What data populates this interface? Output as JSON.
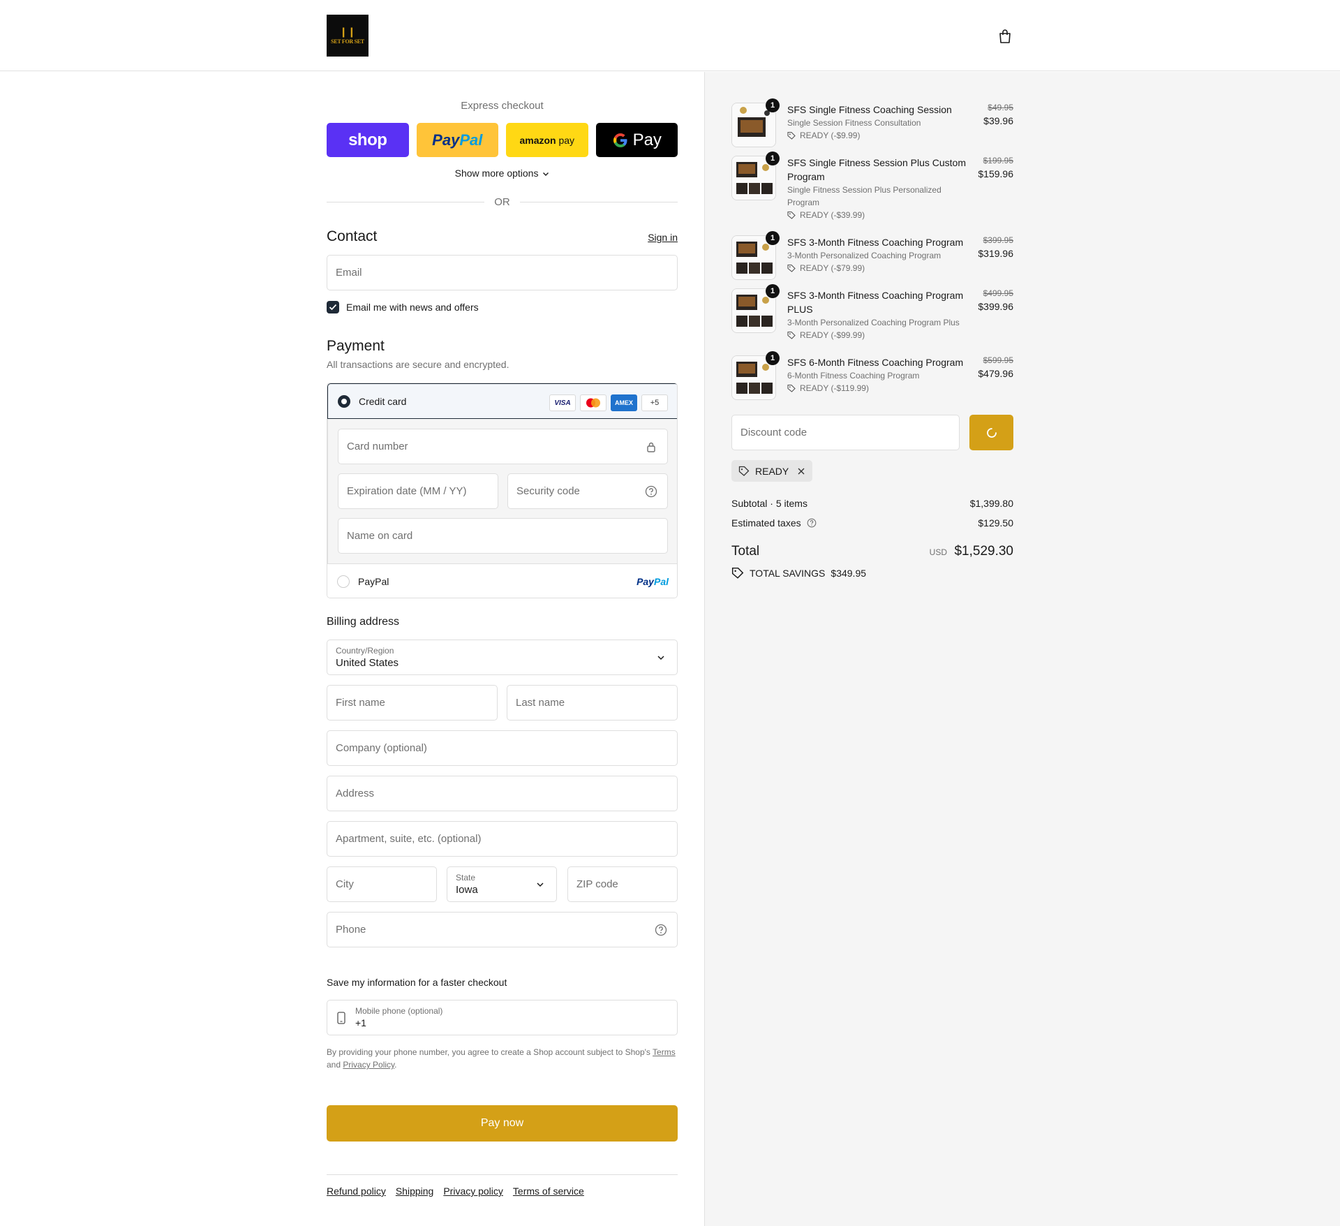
{
  "header": {
    "logo_text": "SET FOR SET",
    "cart_icon": "shopping-bag-icon"
  },
  "express": {
    "label": "Express checkout",
    "shop_label": "shop",
    "paypal_label_a": "Pay",
    "paypal_label_b": "Pal",
    "amazon_label": "amazon",
    "amazon_pay": "pay",
    "gpay_label": "Pay",
    "show_more": "Show more options",
    "or": "OR"
  },
  "contact": {
    "title": "Contact",
    "sign_in": "Sign in",
    "email_placeholder": "Email",
    "news_label": "Email me with news and offers",
    "news_checked": true
  },
  "payment": {
    "title": "Payment",
    "subtitle": "All transactions are secure and encrypted.",
    "credit_card_label": "Credit card",
    "card_brands": [
      "VISA",
      "",
      "AMEX",
      "+5"
    ],
    "card_number_placeholder": "Card number",
    "expiration_placeholder": "Expiration date (MM / YY)",
    "security_placeholder": "Security code",
    "name_placeholder": "Name on card",
    "paypal_label": "PayPal",
    "paypal_logo_a": "Pay",
    "paypal_logo_b": "Pal"
  },
  "billing": {
    "title": "Billing address",
    "country_label": "Country/Region",
    "country_value": "United States",
    "first_name_placeholder": "First name",
    "last_name_placeholder": "Last name",
    "company_placeholder": "Company (optional)",
    "address_placeholder": "Address",
    "apartment_placeholder": "Apartment, suite, etc. (optional)",
    "city_placeholder": "City",
    "state_label": "State",
    "state_value": "Iowa",
    "zip_placeholder": "ZIP code",
    "phone_placeholder": "Phone"
  },
  "save_info": {
    "title": "Save my information for a faster checkout",
    "mobile_label": "Mobile phone (optional)",
    "mobile_value": "+1",
    "legal_a": "By providing your phone number, you agree to create a Shop account subject to Shop's ",
    "legal_terms": "Terms",
    "legal_b": " and ",
    "legal_privacy": "Privacy Policy",
    "legal_c": "."
  },
  "pay_now": "Pay now",
  "footer_links": [
    "Refund policy",
    "Shipping",
    "Privacy policy",
    "Terms of service"
  ],
  "order": {
    "items": [
      {
        "qty": "1",
        "name": "SFS Single Fitness Coaching Session",
        "subtitle": "Single Session Fitness Consultation",
        "discount": "READY (-$9.99)",
        "original": "$49.95",
        "price": "$39.96"
      },
      {
        "qty": "1",
        "name": "SFS Single Fitness Session Plus Custom Program",
        "subtitle": "Single Fitness Session Plus Personalized Program",
        "discount": "READY (-$39.99)",
        "original": "$199.95",
        "price": "$159.96"
      },
      {
        "qty": "1",
        "name": "SFS 3-Month Fitness Coaching Program",
        "subtitle": "3-Month Personalized Coaching Program",
        "discount": "READY (-$79.99)",
        "original": "$399.95",
        "price": "$319.96"
      },
      {
        "qty": "1",
        "name": "SFS 3-Month Fitness Coaching Program PLUS",
        "subtitle": "3-Month Personalized Coaching Program Plus",
        "discount": "READY (-$99.99)",
        "original": "$499.95",
        "price": "$399.96"
      },
      {
        "qty": "1",
        "name": "SFS 6-Month Fitness Coaching Program",
        "subtitle": "6-Month Fitness Coaching Program",
        "discount": "READY (-$119.99)",
        "original": "$599.95",
        "price": "$479.96"
      }
    ],
    "discount_placeholder": "Discount code",
    "applied_code": "READY",
    "subtotal_label": "Subtotal · 5 items",
    "subtotal_value": "$1,399.80",
    "taxes_label": "Estimated taxes",
    "taxes_value": "$129.50",
    "total_label": "Total",
    "currency": "USD",
    "total_value": "$1,529.30",
    "savings_label": "TOTAL SAVINGS",
    "savings_value": "$349.95"
  },
  "colors": {
    "accent": "#d4a017",
    "shop_purple": "#5a31f4",
    "paypal_yellow": "#ffc439",
    "amazon_yellow": "#ffd814",
    "dark": "#1f2a37"
  }
}
